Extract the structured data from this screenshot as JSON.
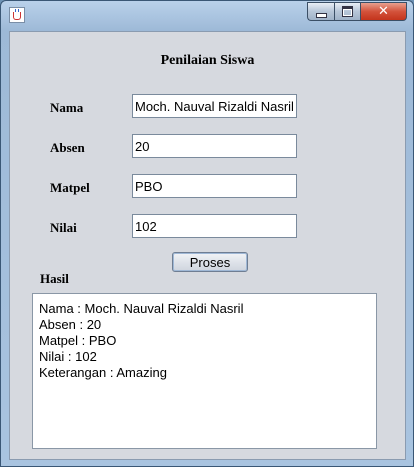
{
  "window": {
    "icon": "java-cup-icon",
    "controls": {
      "minimize": "minimize-icon",
      "maximize": "maximize-icon",
      "close": "close-icon"
    }
  },
  "form": {
    "title": "Penilaian Siswa",
    "fields": {
      "nama": {
        "label": "Nama",
        "value": "Moch. Nauval Rizaldi Nasril"
      },
      "absen": {
        "label": "Absen",
        "value": "20"
      },
      "matpel": {
        "label": "Matpel",
        "value": "PBO"
      },
      "nilai": {
        "label": "Nilai",
        "value": "102"
      }
    },
    "button_label": "Proses",
    "hasil_label": "Hasil"
  },
  "result": {
    "lines": [
      "Nama : Moch. Nauval Rizaldi Nasril",
      "Absen : 20",
      "Matpel : PBO",
      "Nilai : 102",
      "Keterangan : Amazing"
    ]
  }
}
